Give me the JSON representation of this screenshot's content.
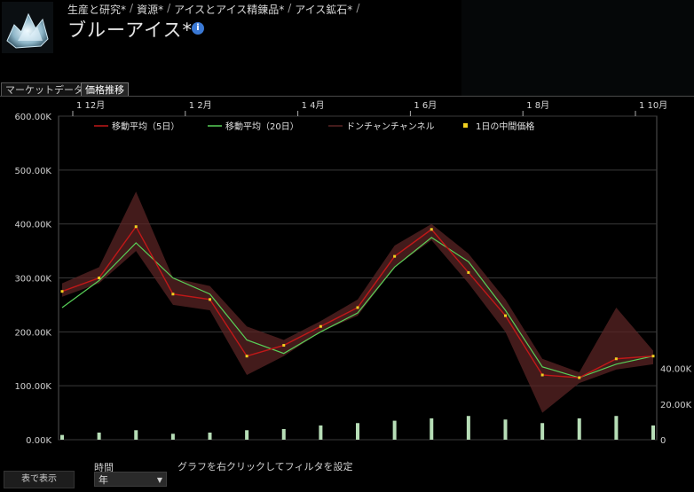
{
  "breadcrumb": {
    "items": [
      "生産と研究*",
      "資源*",
      "アイスとアイス精錬品*",
      "アイス鉱石*"
    ],
    "separator": "/"
  },
  "page_title": "ブルーアイス*",
  "info_icon": "info-icon",
  "tabs": [
    {
      "label": "マーケットデータ",
      "active": false
    },
    {
      "label": "価格推移",
      "active": true
    }
  ],
  "controls": {
    "show_table_label": "表で表示",
    "time_label": "時間",
    "time_value": "年",
    "filter_hint": "グラフを右クリックしてフィルタを設定"
  },
  "colors": {
    "ma5": "#c01818",
    "ma20": "#58d058",
    "donchian": "#5a2424",
    "median": "#f0d020",
    "volume": "#b6ddb6",
    "grid": "#3a3a3a"
  },
  "chart_data": {
    "type": "line",
    "x_labels": [
      "12月",
      "2月",
      "4月",
      "6月",
      "8月",
      "10月"
    ],
    "y_labels": [
      "0.00K",
      "100.00K",
      "200.00K",
      "300.00K",
      "400.00K",
      "500.00K",
      "600.00K"
    ],
    "y2_labels": [
      "0",
      "20.00K",
      "40.00K"
    ],
    "ylim": [
      0,
      600000
    ],
    "y2lim": [
      0,
      60000
    ],
    "legend": [
      "移動平均（5日）",
      "移動平均（20日）",
      "ドンチャンチャンネル",
      "1日の中間価格"
    ],
    "legend_position": "top",
    "grid": true,
    "months": [
      0,
      1,
      2,
      3,
      4,
      5,
      6,
      7,
      8,
      9,
      10,
      11,
      12
    ],
    "ma5": [
      275000,
      300000,
      395000,
      270000,
      260000,
      155000,
      175000,
      210000,
      245000,
      340000,
      390000,
      310000,
      230000,
      120000,
      115000,
      150000,
      155000
    ],
    "ma20": [
      245000,
      295000,
      365000,
      300000,
      270000,
      185000,
      160000,
      200000,
      235000,
      320000,
      375000,
      330000,
      240000,
      135000,
      115000,
      140000,
      155000
    ],
    "donchian_upper": [
      290000,
      320000,
      460000,
      300000,
      285000,
      210000,
      185000,
      220000,
      260000,
      360000,
      400000,
      345000,
      260000,
      150000,
      125000,
      245000,
      165000
    ],
    "donchian_lower": [
      265000,
      290000,
      350000,
      250000,
      240000,
      120000,
      155000,
      200000,
      230000,
      320000,
      370000,
      290000,
      200000,
      50000,
      105000,
      130000,
      140000
    ],
    "volume": [
      4000,
      6000,
      8000,
      5000,
      6000,
      8000,
      9000,
      12000,
      14000,
      16000,
      18000,
      20000,
      17000,
      14000,
      18000,
      20000,
      12000
    ]
  }
}
